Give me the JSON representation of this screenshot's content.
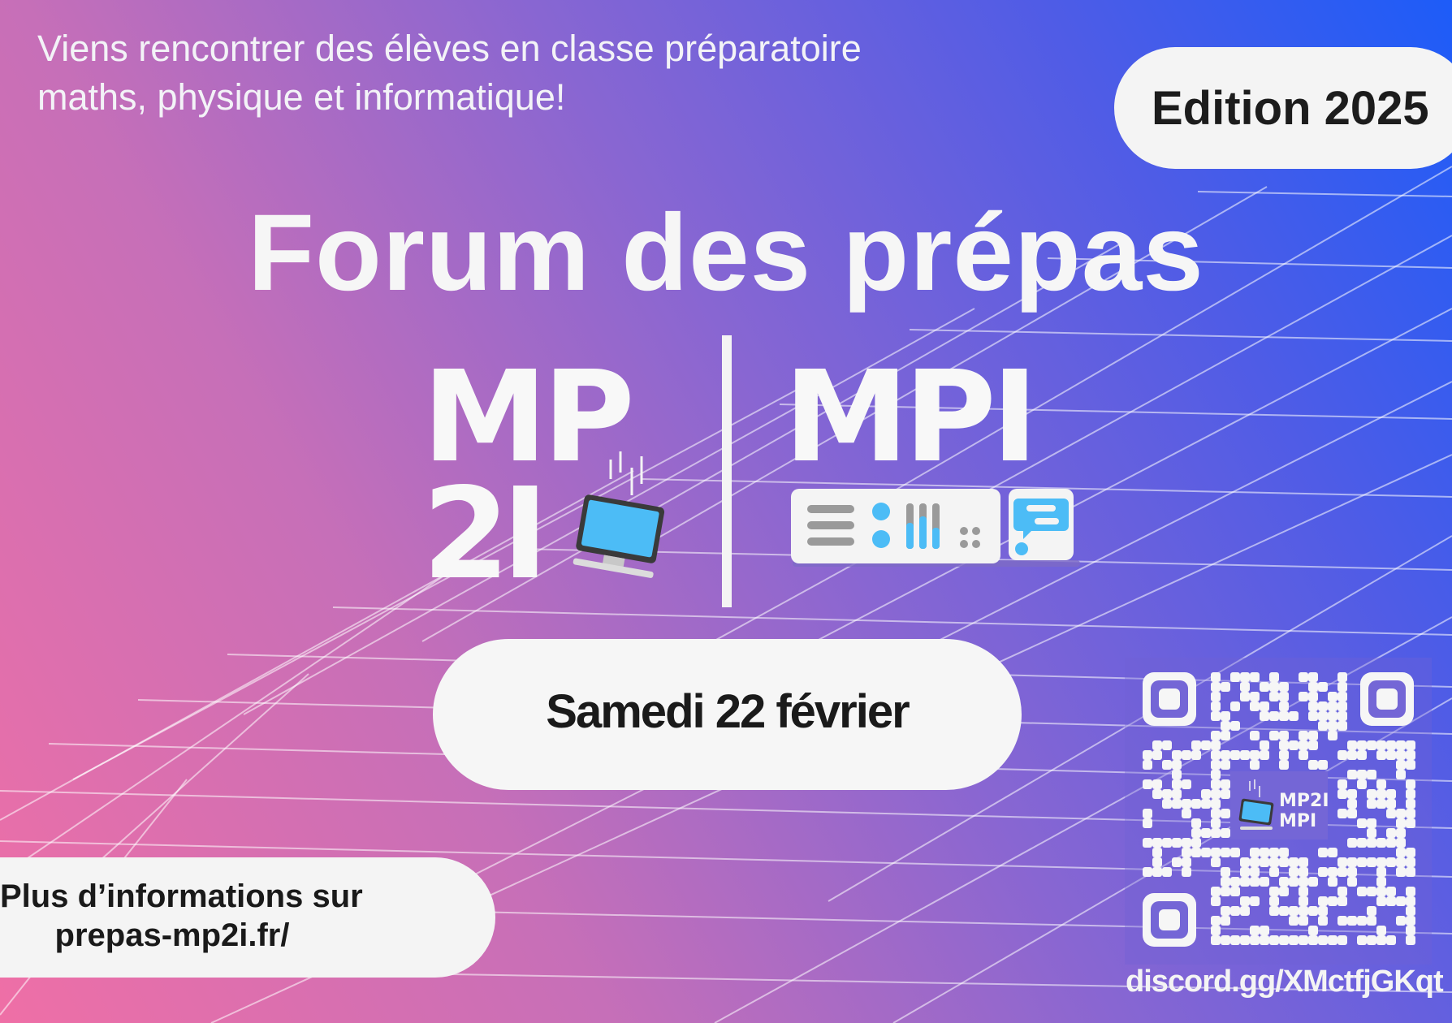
{
  "intro": {
    "line1": "Viens rencontrer des élèves en classe préparatoire",
    "line2": "maths, physique et informatique!"
  },
  "edition_label": "Edition 2025",
  "title": "Forum des prépas",
  "logo": {
    "mp": "MP",
    "two_i": "2I",
    "mpi": "MPI",
    "qr_center_line1": "MP2I",
    "qr_center_line2": "MPI"
  },
  "date_label": "Samedi 22 février",
  "info": {
    "line1": "Plus d’informations sur",
    "line2": "prepas-mp2i.fr/"
  },
  "discord_link": "discord.gg/XMctfjGKqt",
  "icons": [
    "computer-icon",
    "server-rack-icon",
    "chat-icon",
    "qr-code"
  ],
  "colors": {
    "gradient_pink": "#ef6fa6",
    "gradient_violet": "#8866d2",
    "gradient_blue": "#1d5cf8",
    "accent_cyan": "#4cbcf6",
    "card_white": "#f4f4f4",
    "text_dark": "#1a1a1a"
  }
}
